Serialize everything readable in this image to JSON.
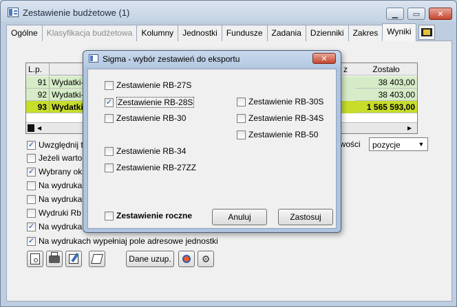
{
  "window": {
    "title": "Zestawienie budżetowe (1)",
    "min": "▁",
    "max": "▭",
    "close": "✕"
  },
  "tabs": [
    {
      "label": "Ogólne"
    },
    {
      "label": "Klasyfikacja budżetowa"
    },
    {
      "label": "Kolumny"
    },
    {
      "label": "Jednostki"
    },
    {
      "label": "Fundusze"
    },
    {
      "label": "Zadania"
    },
    {
      "label": "Dzienniki"
    },
    {
      "label": "Zakres"
    },
    {
      "label": "Wyniki"
    }
  ],
  "table": {
    "headers": [
      "L.p.",
      "",
      "Zostało"
    ],
    "rows": [
      {
        "lp": "91",
        "name": "Wydatki-",
        "value": "38 403,00"
      },
      {
        "lp": "92",
        "name": "Wydatki-",
        "value": "38 403,00"
      },
      {
        "lp": "93",
        "name": "Wydatki",
        "value": "1 565 593,00"
      }
    ],
    "partial_header": "z"
  },
  "options": [
    {
      "label": "Uwzględnij t",
      "checked": true
    },
    {
      "label": "Jeżeli warto",
      "checked": false
    },
    {
      "label": "Wybrany okr",
      "checked": true
    },
    {
      "label": "Na wydrukac",
      "checked": false
    },
    {
      "label": "Na wydrukac",
      "checked": false
    },
    {
      "label": "Wydruki Rb",
      "checked": false
    },
    {
      "label": "Na wydruka",
      "checked": true
    },
    {
      "label": "Na wydrukach wypełniaj pole adresowe jednostki",
      "checked": true
    }
  ],
  "sort": {
    "label": "owości",
    "value": "pozycje"
  },
  "toolbar": {
    "dane_label": "Dane uzup."
  },
  "dialog": {
    "title": "Sigma - wybór zestawień do eksportu",
    "left_items": [
      {
        "label": "Zestawienie RB-27S",
        "checked": false
      },
      {
        "label": "Zestawienie RB-28S",
        "checked": true
      },
      {
        "label": "Zestawienie RB-30",
        "checked": false
      },
      {
        "label": "Zestawienie RB-34",
        "checked": false
      },
      {
        "label": "Zestawienie RB-27ZZ",
        "checked": false
      }
    ],
    "right_items": [
      {
        "label": "Zestawienie RB-30S",
        "checked": false
      },
      {
        "label": "Zestawienie RB-34S",
        "checked": false
      },
      {
        "label": "Zestawienie RB-50",
        "checked": false
      }
    ],
    "yearly": {
      "label": "Zestawienie roczne",
      "checked": false
    },
    "cancel": "Anuluj",
    "apply": "Zastosuj",
    "close": "✕"
  }
}
